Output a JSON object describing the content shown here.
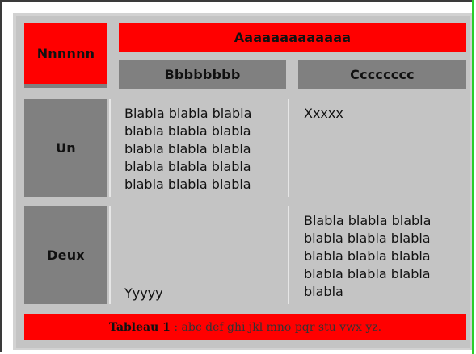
{
  "table": {
    "corner_header": "Nnnnnn",
    "group_header": "Aaaaaaaaaaaaa",
    "col_b": "Bbbbbbbb",
    "col_c": "Cccccccc",
    "rows": [
      {
        "label": "Un",
        "b_lines": [
          "Blabla blabla blabla",
          "blabla blabla blabla",
          "blabla blabla blabla",
          "blabla blabla blabla",
          "blabla blabla blabla"
        ],
        "c_text": "Xxxxx"
      },
      {
        "label": "Deux",
        "b_text": "Yyyyy",
        "c_lines": [
          "Blabla blabla blabla",
          "blabla blabla blabla",
          "blabla blabla blabla",
          "blabla blabla blabla",
          "blabla"
        ]
      }
    ],
    "caption_bold": "Tableau 1",
    "caption_rest": " : abc def ghi jkl mno pqr stu vwx yz."
  },
  "colors": {
    "header_red": "#ff0000",
    "header_gray": "#808080",
    "cell_bg": "#c4c4c4"
  }
}
